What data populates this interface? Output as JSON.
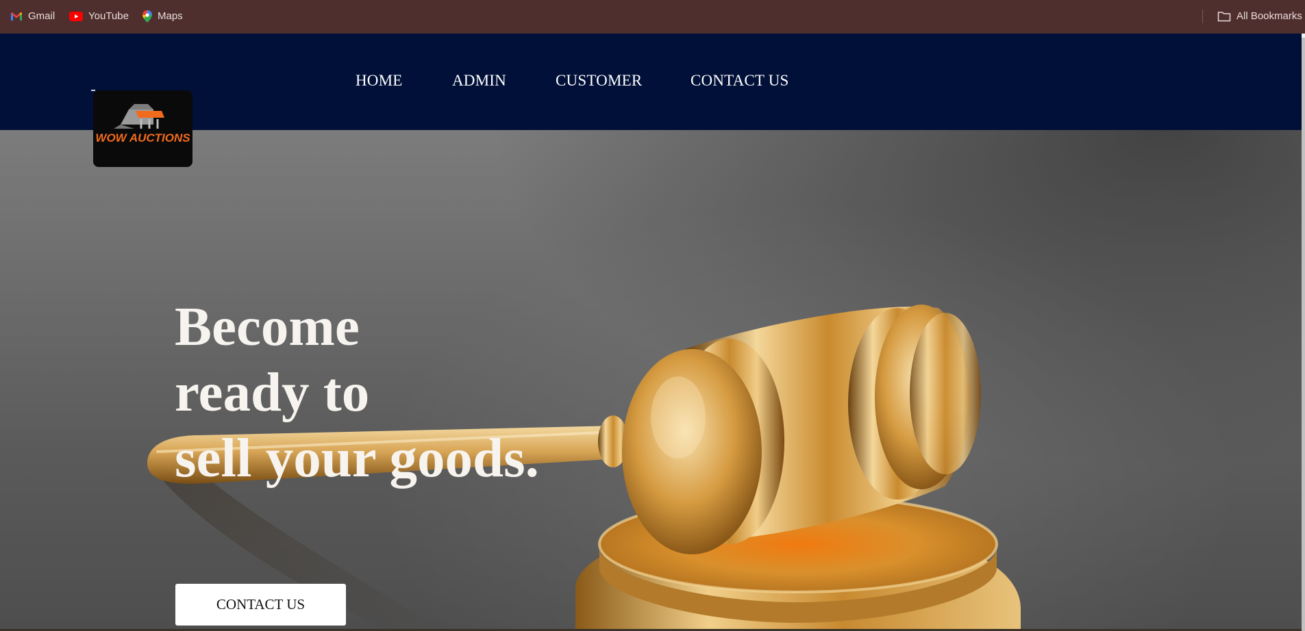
{
  "bookmarks": {
    "items": [
      {
        "label": "Gmail",
        "icon": "gmail-icon"
      },
      {
        "label": "YouTube",
        "icon": "youtube-icon"
      },
      {
        "label": "Maps",
        "icon": "maps-icon"
      }
    ],
    "all_bookmarks": {
      "label": "All Bookmarks",
      "icon": "folder-icon"
    }
  },
  "header": {
    "logo": {
      "text": "WOW AUCTIONS",
      "icon": "shop-stall-logo"
    },
    "nav": [
      {
        "label": "HOME"
      },
      {
        "label": "ADMIN"
      },
      {
        "label": "CUSTOMER"
      },
      {
        "label": "CONTACT US"
      }
    ]
  },
  "hero": {
    "heading_lines": [
      "Become",
      "ready to",
      "sell your goods."
    ],
    "cta_label": "CONTACT US",
    "image": "gold-gavel-image"
  },
  "colors": {
    "bookmarks_bar": "#4f2f2e",
    "navbar": "#011038",
    "logo_accent": "#f26b1d",
    "hero_text": "#f7f3ee",
    "gavel_gold": "#d9a24a"
  }
}
